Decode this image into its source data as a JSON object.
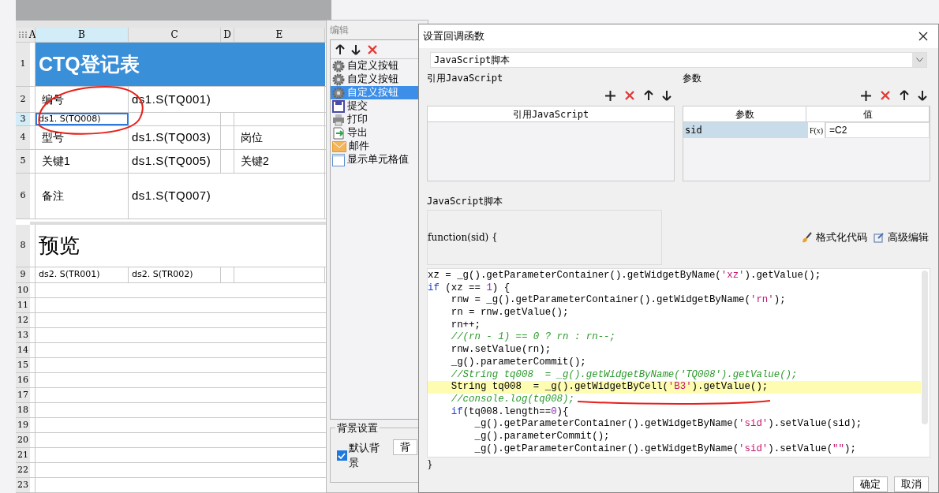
{
  "sheet": {
    "columns": [
      {
        "label": "A",
        "selected": false
      },
      {
        "label": "B",
        "selected": true
      },
      {
        "label": "C",
        "selected": false
      },
      {
        "label": "D",
        "selected": false
      },
      {
        "label": "E",
        "selected": false
      }
    ],
    "rows": [
      {
        "number": "1",
        "selected": false,
        "cells": [
          {
            "kind": "title",
            "text": "CTQ登记表"
          }
        ]
      },
      {
        "number": "2",
        "selected": false,
        "cells": [
          {
            "kind": "label",
            "text": "编号"
          },
          {
            "kind": "value",
            "text": "ds1.S(TQ001)"
          }
        ]
      },
      {
        "number": "3",
        "selected": true,
        "cells": [
          {
            "kind": "small",
            "text": "ds1. S(TQ008)",
            "selected": true
          },
          {
            "kind": "empty"
          },
          {
            "kind": "empty"
          },
          {
            "kind": "empty"
          }
        ]
      },
      {
        "number": "4",
        "selected": false,
        "cells": [
          {
            "kind": "label",
            "text": "型号"
          },
          {
            "kind": "value",
            "text": "ds1.S(TQ003)"
          },
          {
            "kind": "empty"
          },
          {
            "kind": "label",
            "text": "岗位"
          }
        ]
      },
      {
        "number": "5",
        "selected": false,
        "cells": [
          {
            "kind": "label",
            "text": "关键1"
          },
          {
            "kind": "value",
            "text": "ds1.S(TQ005)"
          },
          {
            "kind": "empty"
          },
          {
            "kind": "label",
            "text": "关键2"
          }
        ]
      },
      {
        "number": "6",
        "selected": false,
        "cells": [
          {
            "kind": "label",
            "text": "备注"
          },
          {
            "kind": "value",
            "text": "ds1.S(TQ007)"
          }
        ]
      },
      {
        "number": "8",
        "selected": false,
        "cells": [
          {
            "kind": "heading",
            "text": "预览"
          }
        ]
      },
      {
        "number": "9",
        "selected": false,
        "cells": [
          {
            "kind": "small",
            "text": "ds2. S(TR001)"
          },
          {
            "kind": "small",
            "text": "ds2. S(TR002)"
          },
          {
            "kind": "empty"
          },
          {
            "kind": "empty"
          }
        ]
      },
      {
        "number": "10",
        "selected": false,
        "cells": []
      },
      {
        "number": "11",
        "selected": false,
        "cells": []
      },
      {
        "number": "12",
        "selected": false,
        "cells": []
      },
      {
        "number": "13",
        "selected": false,
        "cells": []
      },
      {
        "number": "14",
        "selected": false,
        "cells": []
      },
      {
        "number": "15",
        "selected": false,
        "cells": []
      },
      {
        "number": "16",
        "selected": false,
        "cells": []
      },
      {
        "number": "17",
        "selected": false,
        "cells": []
      },
      {
        "number": "18",
        "selected": false,
        "cells": []
      },
      {
        "number": "19",
        "selected": false,
        "cells": []
      },
      {
        "number": "20",
        "selected": false,
        "cells": []
      },
      {
        "number": "21",
        "selected": false,
        "cells": []
      },
      {
        "number": "22",
        "selected": false,
        "cells": []
      },
      {
        "number": "23",
        "selected": false,
        "cells": []
      }
    ]
  },
  "edit_panel": {
    "title": "编辑",
    "items": [
      {
        "kind": "gear",
        "label": "自定义按钮",
        "selected": false
      },
      {
        "kind": "gear",
        "label": "自定义按钮",
        "selected": false
      },
      {
        "kind": "gear",
        "label": "自定义按钮",
        "selected": true
      },
      {
        "kind": "save",
        "label": "提交",
        "selected": false
      },
      {
        "kind": "print",
        "label": "打印",
        "selected": false
      },
      {
        "kind": "export",
        "label": "导出",
        "selected": false
      },
      {
        "kind": "mail",
        "label": "邮件",
        "selected": false
      },
      {
        "kind": "cell",
        "label": "显示单元格值",
        "selected": false
      }
    ],
    "background_group": "背景设置",
    "default_background": {
      "label": "默认背景",
      "checked": true
    },
    "background_button": "背"
  },
  "dialog": {
    "title": "设置回调函数",
    "script_type": "JavaScript脚本",
    "ref_section": {
      "title": "引用JavaScript",
      "column": "引用JavaScript"
    },
    "param_section": {
      "title": "参数",
      "columns": [
        "参数",
        "值"
      ],
      "rows": [
        {
          "name": "sid",
          "formula_button": "F(x)",
          "value": "=C2"
        }
      ]
    },
    "script_section": {
      "title": "JavaScript脚本",
      "header": "function(sid) {",
      "format_button": "格式化代码",
      "advanced_button": "高级编辑",
      "lines": [
        {
          "highlighted": false,
          "tokens": [
            {
              "kind": "plain",
              "text": "xz = _g().getParameterContainer().getWidgetByName("
            },
            {
              "kind": "string",
              "text": "'xz'"
            },
            {
              "kind": "plain",
              "text": ").getValue();"
            }
          ]
        },
        {
          "highlighted": false,
          "tokens": [
            {
              "kind": "keyword",
              "text": "if"
            },
            {
              "kind": "plain",
              "text": " (xz == "
            },
            {
              "kind": "number",
              "text": "1"
            },
            {
              "kind": "plain",
              "text": ") {"
            }
          ]
        },
        {
          "highlighted": false,
          "tokens": [
            {
              "kind": "plain",
              "text": "    rnw = _g().getParameterContainer().getWidgetByName("
            },
            {
              "kind": "string",
              "text": "'rn'"
            },
            {
              "kind": "plain",
              "text": ");"
            }
          ]
        },
        {
          "highlighted": false,
          "tokens": [
            {
              "kind": "plain",
              "text": "    rn = rnw.getValue();"
            }
          ]
        },
        {
          "highlighted": false,
          "tokens": [
            {
              "kind": "plain",
              "text": "    rn++;"
            }
          ]
        },
        {
          "highlighted": false,
          "tokens": [
            {
              "kind": "comment",
              "text": "    //(rn - 1) == 0 ? rn : rn--;"
            }
          ]
        },
        {
          "highlighted": false,
          "tokens": [
            {
              "kind": "plain",
              "text": "    rnw.setValue(rn);"
            }
          ]
        },
        {
          "highlighted": false,
          "tokens": [
            {
              "kind": "plain",
              "text": "    _g().parameterCommit();"
            }
          ]
        },
        {
          "highlighted": false,
          "tokens": [
            {
              "kind": "comment",
              "text": "    //String tq008  = _g().getWidgetByName('TQ008').getValue();"
            }
          ]
        },
        {
          "highlighted": true,
          "tokens": [
            {
              "kind": "plain",
              "text": "    String tq008  = _g().getWidgetByCell("
            },
            {
              "kind": "string",
              "text": "'B3'"
            },
            {
              "kind": "plain",
              "text": ").getValue();"
            }
          ]
        },
        {
          "highlighted": false,
          "tokens": [
            {
              "kind": "comment",
              "text": "    //console.log(tq008);"
            }
          ]
        },
        {
          "highlighted": false,
          "tokens": [
            {
              "kind": "keyword",
              "text": "    if"
            },
            {
              "kind": "plain",
              "text": "(tq008.length=="
            },
            {
              "kind": "number",
              "text": "0"
            },
            {
              "kind": "plain",
              "text": "){"
            }
          ]
        },
        {
          "highlighted": false,
          "tokens": [
            {
              "kind": "plain",
              "text": "        _g().getParameterContainer().getWidgetByName("
            },
            {
              "kind": "string",
              "text": "'sid'"
            },
            {
              "kind": "plain",
              "text": ").setValue(sid);"
            }
          ]
        },
        {
          "highlighted": false,
          "tokens": [
            {
              "kind": "plain",
              "text": "        _g().parameterCommit();"
            }
          ]
        },
        {
          "highlighted": false,
          "tokens": [
            {
              "kind": "plain",
              "text": "        _g().getParameterContainer().getWidgetByName("
            },
            {
              "kind": "string",
              "text": "'sid'"
            },
            {
              "kind": "plain",
              "text": ").setValue("
            },
            {
              "kind": "string",
              "text": "\"\""
            },
            {
              "kind": "plain",
              "text": ");"
            }
          ]
        }
      ],
      "footer": "}"
    },
    "buttons": [
      "确定",
      "取消"
    ]
  }
}
